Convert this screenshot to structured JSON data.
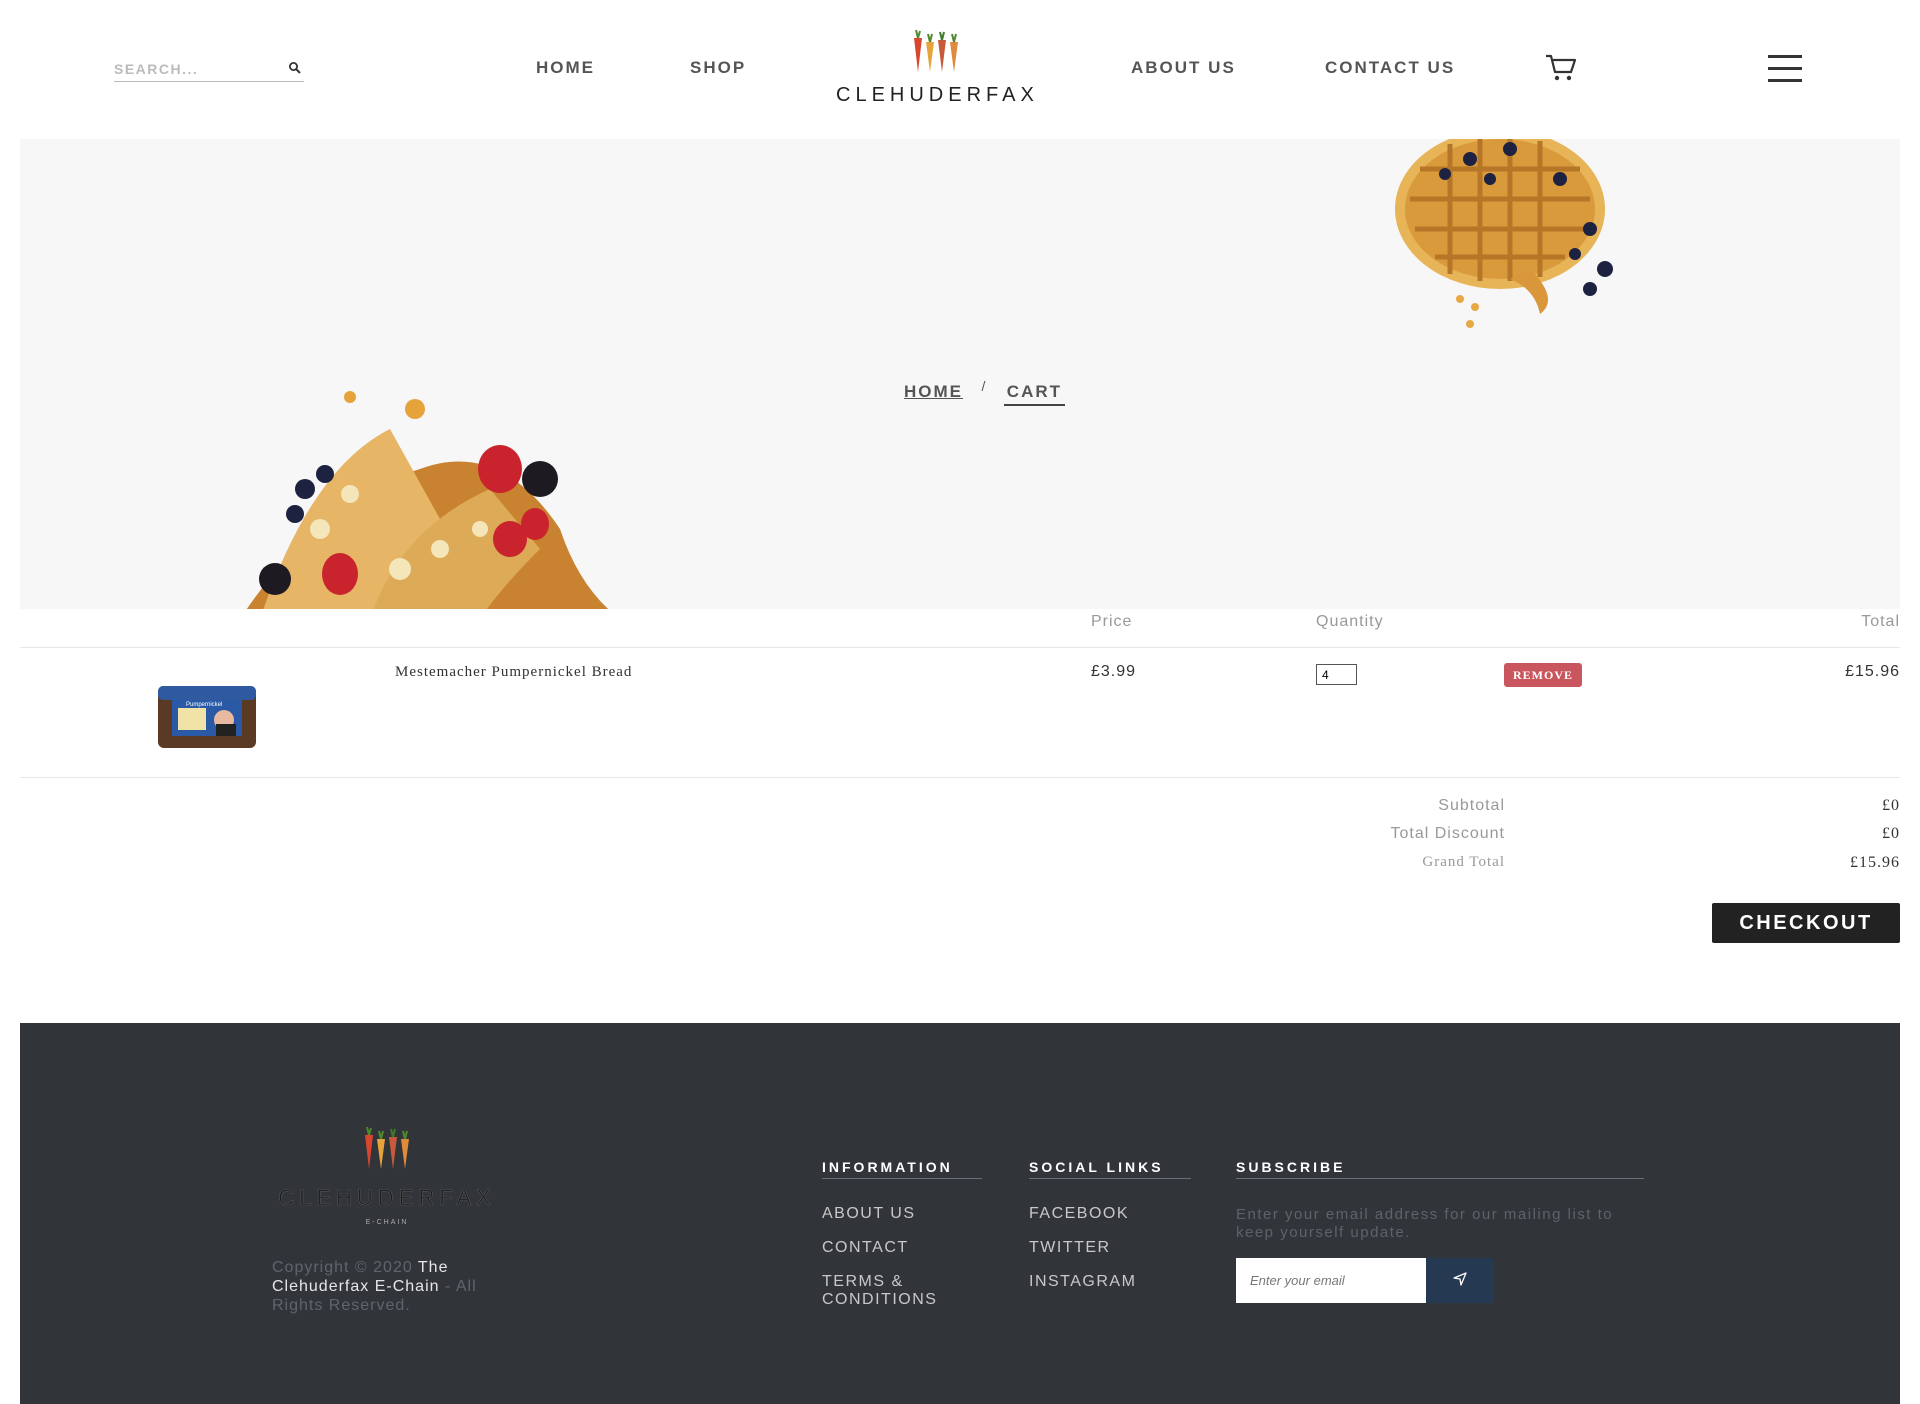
{
  "header": {
    "search_placeholder": "SEARCH...",
    "nav": {
      "home": "HOME",
      "shop": "SHOP",
      "about": "ABOUT US",
      "contact": "CONTACT US"
    },
    "brand": "CLEHUDERFAX"
  },
  "breadcrumb": {
    "home": "HOME",
    "separator": "/",
    "current": "CART"
  },
  "cart": {
    "columns": {
      "price": "Price",
      "quantity": "Quantity",
      "total": "Total"
    },
    "items": [
      {
        "name": "Mestemacher Pumpernickel Bread",
        "price": "£3.99",
        "quantity": "4",
        "remove_label": "REMOVE",
        "total": "£15.96"
      }
    ],
    "summary": {
      "subtotal_label": "Subtotal",
      "subtotal_value": "£0",
      "discount_label": "Total Discount",
      "discount_value": "£0",
      "grand_label": "Grand Total",
      "grand_value": "£15.96"
    },
    "checkout_label": "CHECKOUT"
  },
  "footer": {
    "brand": "CLEHUDERFAX",
    "brand_sub": "E-CHAIN",
    "copyright_prefix": "Copyright © 2020",
    "copyright_name": "The Clehuderfax E-Chain",
    "copyright_suffix": "- All Rights Reserved.",
    "information": {
      "heading": "INFORMATION",
      "links": [
        "ABOUT US",
        "CONTACT",
        "TERMS & CONDITIONS"
      ]
    },
    "social": {
      "heading": "SOCIAL LINKS",
      "links": [
        "FACEBOOK",
        "TWITTER",
        "INSTAGRAM"
      ]
    },
    "subscribe": {
      "heading": "SUBSCRIBE",
      "text": "Enter your email address for our mailing list to keep yourself update.",
      "placeholder": "Enter your email"
    }
  },
  "colors": {
    "accent_remove": "#c9565f",
    "checkout_bg": "#222222",
    "footer_bg": "#31353a",
    "subscribe_button": "#253a52"
  },
  "icons": [
    "search-icon",
    "cart-icon",
    "hamburger-menu-icon",
    "send-icon"
  ]
}
